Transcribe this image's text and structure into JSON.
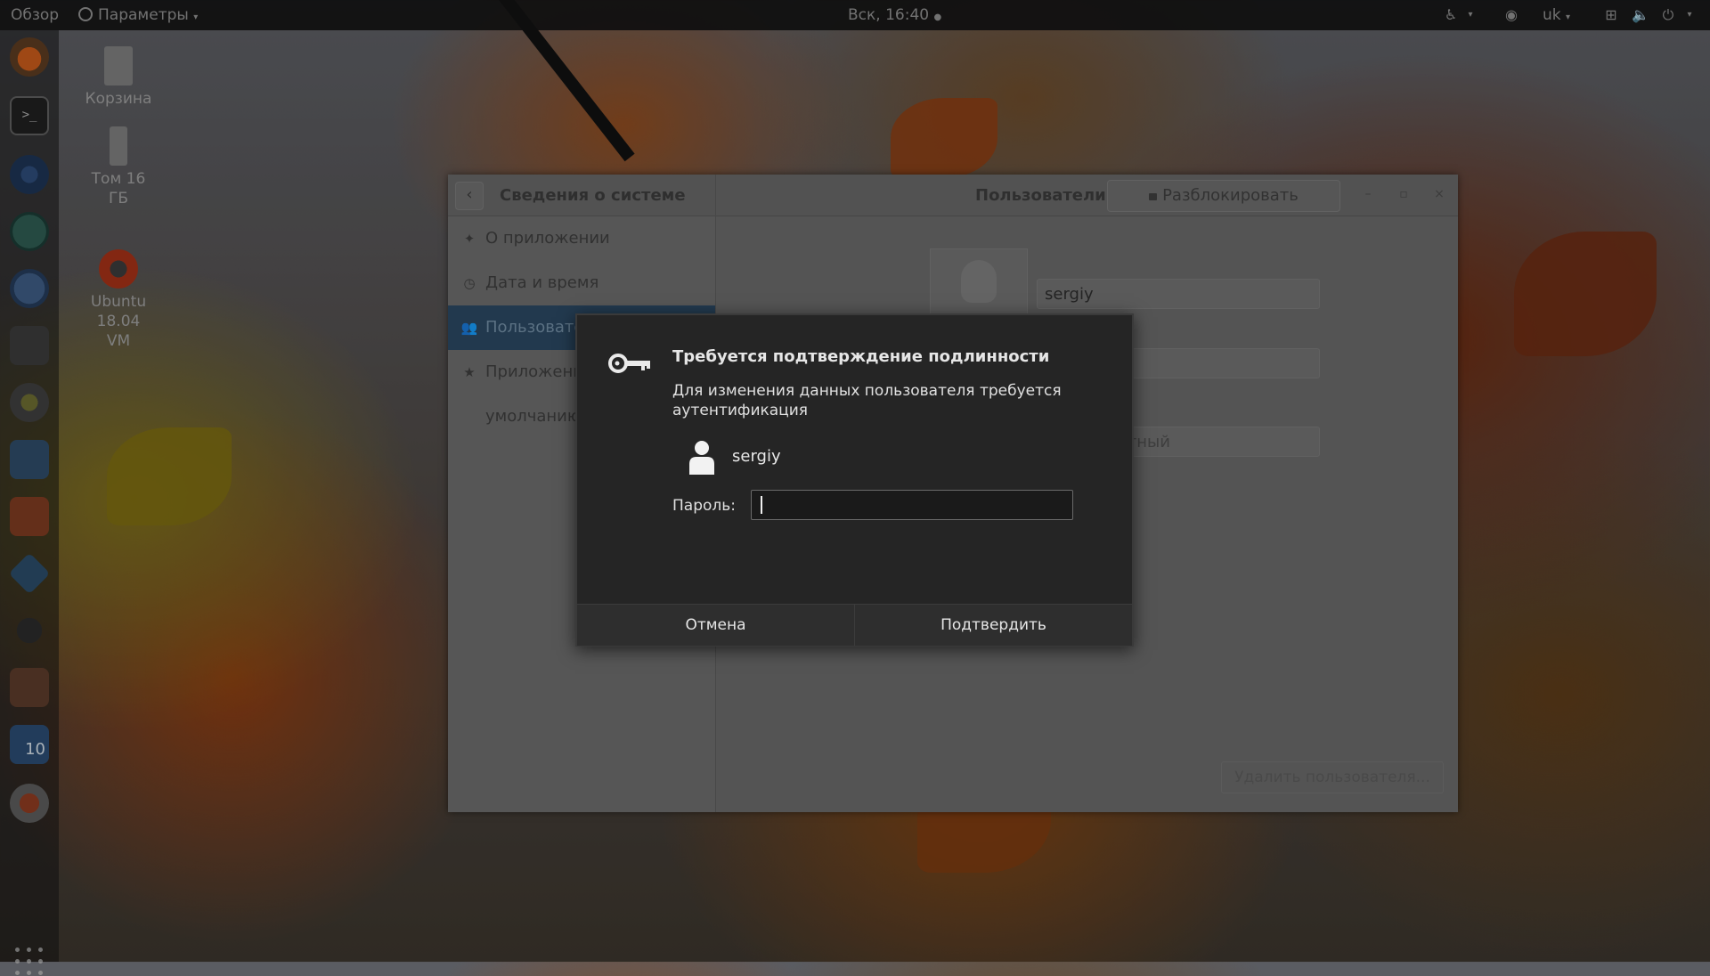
{
  "topbar": {
    "overview": "Обзор",
    "app_menu": "Параметры",
    "clock": "Вск, 16:40",
    "keyboard_layout": "uk"
  },
  "desktop": {
    "icons": [
      {
        "label": "Корзина"
      },
      {
        "label": "Том 16 ГБ"
      },
      {
        "label": "Ubuntu 18.04 VM"
      }
    ]
  },
  "dock": {
    "apps": [
      "firefox-icon",
      "terminal-icon",
      "chromium-icon",
      "atom-icon",
      "thunderbird-icon",
      "files-icon",
      "rhythmbox-icon",
      "writer-icon",
      "software-center-icon",
      "virtualbox-icon",
      "inkscape-icon",
      "installer-icon",
      "windows-10-icon",
      "settings-icon"
    ],
    "windows10_badge": "10"
  },
  "settings_window": {
    "left_title": "Сведения о системе",
    "right_title": "Пользователи",
    "unlock_label": "Разблокировать",
    "sidebar": [
      {
        "icon": "star-outline-icon",
        "label": "О приложении"
      },
      {
        "icon": "clock-icon",
        "label": "Дата и время"
      },
      {
        "icon": "users-icon",
        "label": "Пользователи"
      },
      {
        "icon": "star-icon",
        "label": "Приложения по умолчанию"
      }
    ],
    "user": {
      "name_value": "sergiy",
      "account_type_value": "Стандартный"
    },
    "delete_user_label": "Удалить пользователя..."
  },
  "auth_dialog": {
    "title": "Требуется подтверждение подлинности",
    "message": "Для изменения данных пользователя требуется аутентификация",
    "username": "sergiy",
    "password_label": "Пароль:",
    "password_value": "",
    "cancel_label": "Отмена",
    "confirm_label": "Подтвердить"
  }
}
